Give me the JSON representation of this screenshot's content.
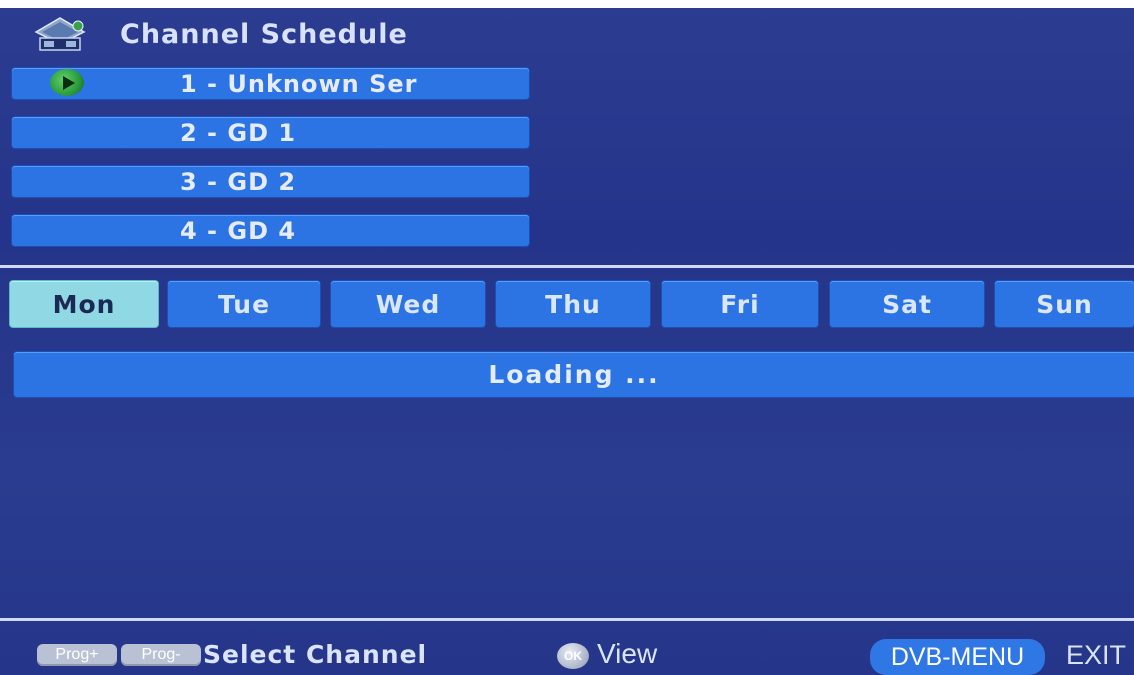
{
  "header": {
    "title": "Channel Schedule",
    "icon": "schedule-icon"
  },
  "channels": [
    {
      "label": "1 - Unknown Ser",
      "selected": true
    },
    {
      "label": "2 - GD 1"
    },
    {
      "label": "3 - GD 2"
    },
    {
      "label": "4 - GD 4"
    }
  ],
  "days": [
    {
      "label": "Mon",
      "active": true
    },
    {
      "label": "Tue"
    },
    {
      "label": "Wed"
    },
    {
      "label": "Thu"
    },
    {
      "label": "Fri"
    },
    {
      "label": "Sat"
    },
    {
      "label": "Sun"
    }
  ],
  "schedule": {
    "status": "Loading ..."
  },
  "footer": {
    "prog_plus": "Prog+",
    "prog_minus": "Prog-",
    "select_channel": "Select Channel",
    "ok_label": "OK",
    "view": "View",
    "dvb_menu": "DVB-MENU",
    "exit": "EXIT"
  },
  "colors": {
    "background": "#2a3b8c",
    "item": "#2c74e4",
    "active_day": "#8fd8e4"
  }
}
